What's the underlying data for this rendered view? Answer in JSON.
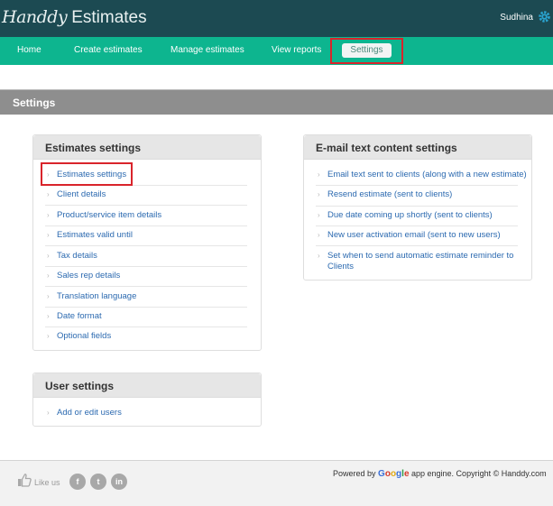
{
  "app": {
    "brand_script": "Handdy",
    "brand_plain": "Estimates",
    "user_name": "Sudhina"
  },
  "nav": {
    "items": [
      {
        "label": "Home"
      },
      {
        "label": "Create estimates"
      },
      {
        "label": "Manage estimates"
      },
      {
        "label": "View reports"
      },
      {
        "label": "Settings"
      }
    ],
    "active": "Settings"
  },
  "page": {
    "title": "Settings"
  },
  "estimates_settings": {
    "title": "Estimates settings",
    "links": [
      "Estimates settings",
      "Client details",
      "Product/service item details",
      "Estimates valid until",
      "Tax details",
      "Sales rep details",
      "Translation language",
      "Date format",
      "Optional fields"
    ]
  },
  "user_settings": {
    "title": "User settings",
    "links": [
      "Add or edit users"
    ]
  },
  "email_settings": {
    "title": "E-mail text content settings",
    "links": [
      "Email text sent to clients (along with a new estimate)",
      "Resend estimate (sent to clients)",
      "Due date coming up shortly (sent to clients)",
      "New user activation email (sent to new users)",
      "Set when to send automatic estimate reminder to Clients"
    ]
  },
  "footer": {
    "like_text": "Like us",
    "social": [
      "f",
      "t",
      "in"
    ],
    "powered_prefix": "Powered by",
    "google": [
      "G",
      "o",
      "o",
      "g",
      "l",
      "e"
    ],
    "powered_suffix": "app engine. Copyright © Handdy.com"
  },
  "colors": {
    "topbar": "#1c4a52",
    "navbar": "#0db58f",
    "link": "#2c6ab0",
    "highlight": "#d9242b"
  }
}
